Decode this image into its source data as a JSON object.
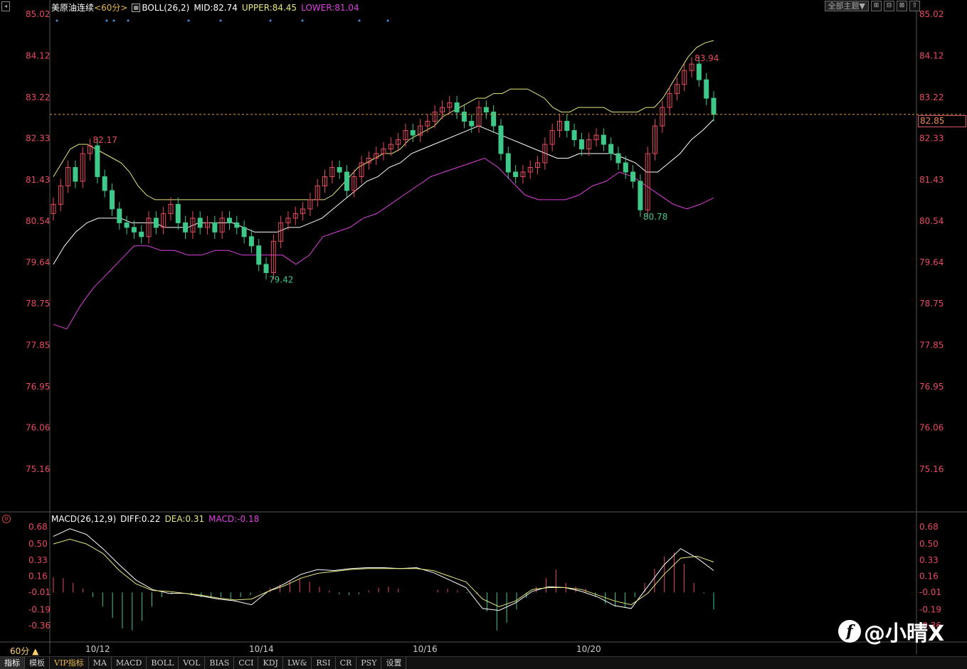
{
  "header": {
    "symbol": "美原油连续",
    "period_tag": "<60分>",
    "indicator": "BOLL(26,2)",
    "mid": "MID:82.74",
    "upper": "UPPER:84.45",
    "lower": "LOWER:81.04"
  },
  "toolbar": {
    "theme_label": "全部主题▼",
    "btn1": "⊞",
    "btn2": "⊟",
    "btn3": "⊠",
    "btn4": "⇧"
  },
  "current_price": "82.85",
  "macd_header": {
    "title": "MACD(26,12,9)",
    "diff": "DIFF:0.22",
    "dea": "DEA:0.31",
    "macd": "MACD:-0.18"
  },
  "period_label": "60分 ▲",
  "date_labels": [
    "10/12",
    "10/14",
    "10/16",
    "10/20"
  ],
  "tabs": [
    "指标",
    "模板",
    "VIP指标",
    "MA",
    "MACD",
    "BOLL",
    "VOL",
    "BIAS",
    "CCI",
    "KDJ",
    "LW&",
    "RSI",
    "CR",
    "PSY",
    "设置"
  ],
  "watermark": "@小晴X",
  "watermark_logo": "f",
  "colors": {
    "up": "#e84a5f",
    "down": "#3ec98a",
    "upper": "#e8e87a",
    "mid": "#ffffff",
    "lower": "#e040e0",
    "axis": "#e84a5f"
  },
  "chart_data": [
    {
      "type": "candlestick",
      "title": "美原油连续",
      "yticks": [
        85.02,
        84.12,
        83.22,
        82.33,
        81.43,
        80.54,
        79.64,
        78.75,
        77.85,
        76.95,
        76.06,
        75.16
      ],
      "ylim": [
        74.3,
        85.02
      ],
      "annotations": [
        {
          "label": "82.17",
          "value": 82.17
        },
        {
          "label": "79.42",
          "value": 79.42
        },
        {
          "label": "80.78",
          "value": 80.78
        },
        {
          "label": "83.94",
          "value": 83.94
        }
      ],
      "close_series": [
        80.9,
        81.3,
        81.7,
        81.4,
        82.0,
        82.17,
        81.5,
        81.2,
        80.8,
        80.5,
        80.4,
        80.3,
        80.2,
        80.6,
        80.4,
        80.7,
        80.9,
        80.5,
        80.3,
        80.6,
        80.4,
        80.5,
        80.3,
        80.6,
        80.5,
        80.4,
        80.2,
        80.0,
        79.6,
        79.42,
        80.1,
        80.5,
        80.6,
        80.7,
        80.8,
        81.0,
        81.3,
        81.5,
        81.7,
        81.6,
        81.2,
        81.5,
        81.8,
        81.9,
        82.0,
        82.1,
        82.2,
        82.3,
        82.5,
        82.4,
        82.6,
        82.7,
        82.9,
        83.0,
        83.1,
        82.9,
        82.7,
        82.6,
        83.0,
        82.9,
        82.6,
        82.0,
        81.6,
        81.5,
        81.6,
        81.7,
        81.8,
        82.2,
        82.5,
        82.7,
        82.5,
        82.3,
        82.1,
        82.3,
        82.4,
        82.2,
        82.0,
        81.8,
        81.6,
        81.4,
        80.78,
        82.0,
        82.6,
        83.0,
        83.3,
        83.5,
        83.8,
        83.94,
        83.6,
        83.2,
        82.85
      ],
      "upper_series": [
        81.5,
        81.8,
        82.1,
        82.2,
        82.2,
        82.1,
        82.0,
        81.9,
        81.8,
        81.6,
        81.3,
        81.1,
        81.0,
        81.0,
        81.0,
        81.0,
        81.0,
        81.0,
        81.0,
        81.0,
        81.0,
        81.0,
        81.0,
        81.0,
        81.0,
        81.0,
        81.0,
        81.0,
        81.0,
        81.0,
        81.0,
        81.0,
        81.0,
        81.1,
        81.3,
        81.5,
        81.7,
        81.8,
        81.9,
        82.0,
        82.0,
        82.1,
        82.3,
        82.4,
        82.5,
        82.6,
        82.8,
        82.9,
        83.0,
        83.1,
        83.2,
        83.2,
        83.3,
        83.3,
        83.4,
        83.4,
        83.4,
        83.3,
        83.2,
        83.0,
        82.9,
        82.9,
        83.0,
        83.0,
        83.0,
        83.0,
        82.9,
        82.9,
        82.9,
        82.9,
        83.0,
        83.0,
        83.2,
        83.5,
        83.8,
        84.1,
        84.3,
        84.4,
        84.45
      ],
      "mid_series": [
        79.6,
        80.0,
        80.3,
        80.5,
        80.6,
        80.6,
        80.6,
        80.5,
        80.5,
        80.5,
        80.4,
        80.4,
        80.4,
        80.5,
        80.5,
        80.5,
        80.5,
        80.4,
        80.3,
        80.3,
        80.3,
        80.4,
        80.4,
        80.5,
        80.6,
        80.8,
        81.0,
        81.2,
        81.4,
        81.5,
        81.7,
        81.8,
        82.0,
        82.1,
        82.2,
        82.3,
        82.4,
        82.5,
        82.6,
        82.5,
        82.4,
        82.3,
        82.2,
        82.1,
        82.0,
        81.9,
        81.9,
        82.0,
        82.0,
        82.0,
        82.0,
        81.9,
        81.8,
        81.6,
        81.6,
        81.8,
        82.0,
        82.3,
        82.5,
        82.74
      ],
      "lower_series": [
        78.3,
        78.2,
        78.7,
        79.1,
        79.4,
        79.7,
        80.0,
        80.0,
        79.9,
        79.9,
        79.8,
        79.8,
        79.9,
        79.9,
        79.8,
        79.8,
        79.8,
        79.8,
        79.6,
        79.8,
        80.2,
        80.3,
        80.4,
        80.6,
        80.7,
        80.9,
        81.1,
        81.3,
        81.5,
        81.6,
        81.7,
        81.8,
        81.9,
        81.7,
        81.4,
        81.1,
        81.0,
        81.0,
        81.0,
        81.1,
        81.3,
        81.4,
        81.6,
        81.5,
        81.3,
        81.1,
        80.9,
        80.8,
        80.9,
        81.04
      ]
    },
    {
      "type": "bar",
      "title": "MACD(26,12,9)",
      "yticks": [
        0.68,
        0.5,
        0.33,
        0.16,
        -0.01,
        -0.19,
        -0.36
      ],
      "ylim": [
        -0.45,
        0.76
      ],
      "histogram": [
        0.16,
        0.15,
        0.1,
        0.04,
        -0.05,
        -0.15,
        -0.27,
        -0.38,
        -0.4,
        -0.3,
        -0.15,
        -0.05,
        -0.02,
        0.0,
        -0.03,
        -0.05,
        -0.06,
        -0.05,
        -0.07,
        -0.05,
        -0.03,
        0.01,
        0.05,
        0.08,
        0.12,
        0.14,
        0.11,
        0.06,
        0.02,
        -0.02,
        -0.03,
        -0.02,
        0.02,
        0.05,
        0.06,
        0.04,
        0.0,
        0.0,
        0.0,
        0.03,
        0.04,
        0.02,
        -0.01,
        -0.02,
        -0.2,
        -0.4,
        -0.32,
        -0.18,
        -0.06,
        0.06,
        0.15,
        0.24,
        0.1,
        0.06,
        0.04,
        -0.05,
        -0.12,
        -0.15,
        -0.16,
        -0.05,
        0.1,
        0.25,
        0.38,
        0.42,
        0.3,
        0.1,
        -0.01,
        -0.18
      ],
      "diff": [
        0.58,
        0.66,
        0.6,
        0.45,
        0.28,
        0.12,
        0.02,
        -0.02,
        -0.02,
        -0.05,
        -0.08,
        -0.1,
        -0.14,
        0.0,
        0.08,
        0.18,
        0.23,
        0.22,
        0.24,
        0.25,
        0.25,
        0.24,
        0.25,
        0.2,
        0.12,
        0.04,
        -0.18,
        -0.2,
        -0.12,
        0.0,
        0.05,
        0.04,
        0.0,
        -0.06,
        -0.15,
        -0.18,
        0.05,
        0.28,
        0.45,
        0.35,
        0.22
      ],
      "dea": [
        0.5,
        0.55,
        0.5,
        0.4,
        0.22,
        0.08,
        0.01,
        0.0,
        -0.02,
        -0.04,
        -0.07,
        -0.09,
        -0.08,
        0.0,
        0.06,
        0.14,
        0.19,
        0.21,
        0.23,
        0.24,
        0.24,
        0.24,
        0.24,
        0.22,
        0.16,
        0.1,
        -0.08,
        -0.16,
        -0.1,
        0.02,
        0.04,
        0.04,
        0.02,
        -0.04,
        -0.1,
        -0.14,
        -0.02,
        0.18,
        0.35,
        0.37,
        0.31
      ]
    }
  ]
}
